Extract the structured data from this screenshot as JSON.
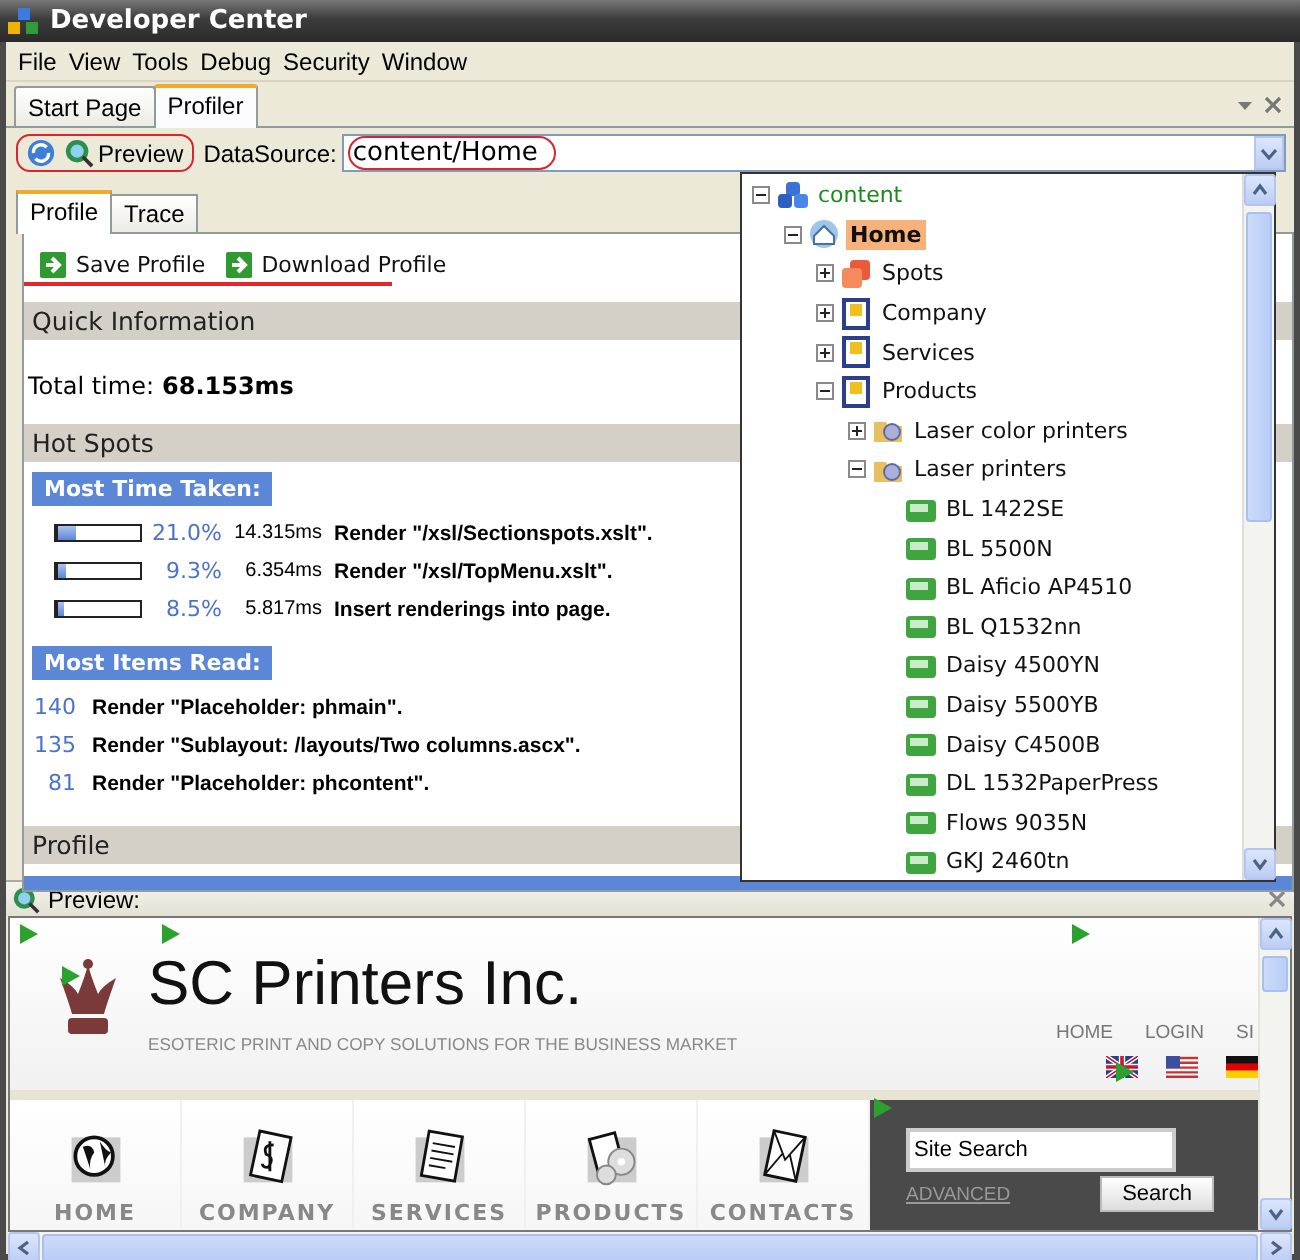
{
  "window": {
    "title": "Developer Center"
  },
  "menu": [
    "File",
    "View",
    "Tools",
    "Debug",
    "Security",
    "Window"
  ],
  "document_tabs": [
    {
      "label": "Start Page",
      "selected": false
    },
    {
      "label": "Profiler",
      "selected": true
    }
  ],
  "toolbar": {
    "preview_button": "Preview",
    "datasource_label": "DataSource:",
    "datasource_value": "content/Home"
  },
  "profiler_tabs": [
    {
      "label": "Profile",
      "selected": true
    },
    {
      "label": "Trace",
      "selected": false
    }
  ],
  "actions": [
    "Save Profile",
    "Download Profile"
  ],
  "quick_information": {
    "heading": "Quick Information",
    "total_time_label": "Total time:",
    "total_time_value": "68.153ms"
  },
  "hot_spots": {
    "heading": "Hot Spots",
    "most_time_taken": {
      "heading": "Most Time Taken:",
      "rows": [
        {
          "level": 0.21,
          "percent": "21.0%",
          "time": "14.315ms",
          "description": "Render \"/xsl/Sectionspots.xslt\"."
        },
        {
          "level": 0.093,
          "percent": "9.3%",
          "time": "6.354ms",
          "description": "Render \"/xsl/TopMenu.xslt\"."
        },
        {
          "level": 0.085,
          "percent": "8.5%",
          "time": "5.817ms",
          "description": "Insert renderings into page."
        }
      ]
    },
    "most_items_read": {
      "heading": "Most Items Read:",
      "rows": [
        {
          "count": "140",
          "description": "Render \"Placeholder: phmain\"."
        },
        {
          "count": "135",
          "description": "Render \"Sublayout: /layouts/Two columns.ascx\"."
        },
        {
          "count": "81",
          "description": "Render \"Placeholder: phcontent\"."
        }
      ]
    }
  },
  "profile": {
    "heading": "Profile"
  },
  "tree": [
    {
      "label": "content",
      "kind": "root",
      "expanded": true,
      "selected": false,
      "children": [
        {
          "label": "Home",
          "kind": "home",
          "expanded": true,
          "selected": true,
          "children": [
            {
              "label": "Spots",
              "kind": "spots",
              "expanded": false,
              "selected": false
            },
            {
              "label": "Company",
              "kind": "page",
              "expanded": false,
              "selected": false
            },
            {
              "label": "Services",
              "kind": "page",
              "expanded": false,
              "selected": false
            },
            {
              "label": "Products",
              "kind": "page",
              "expanded": true,
              "selected": false,
              "children": [
                {
                  "label": "Laser color printers",
                  "kind": "category",
                  "expanded": false,
                  "selected": false
                },
                {
                  "label": "Laser printers",
                  "kind": "category",
                  "expanded": true,
                  "selected": false,
                  "children": [
                    {
                      "label": "BL 1422SE",
                      "kind": "product",
                      "selected": false
                    },
                    {
                      "label": "BL 5500N",
                      "kind": "product",
                      "selected": false
                    },
                    {
                      "label": "BL Aficio AP4510",
                      "kind": "product",
                      "selected": false
                    },
                    {
                      "label": "BL Q1532nn",
                      "kind": "product",
                      "selected": false
                    },
                    {
                      "label": "Daisy 4500YN",
                      "kind": "product",
                      "selected": false
                    },
                    {
                      "label": "Daisy 5500YB",
                      "kind": "product",
                      "selected": false
                    },
                    {
                      "label": "Daisy C4500B",
                      "kind": "product",
                      "selected": false
                    },
                    {
                      "label": "DL 1532PaperPress",
                      "kind": "product",
                      "selected": false
                    },
                    {
                      "label": "Flows 9035N",
                      "kind": "product",
                      "selected": false
                    },
                    {
                      "label": "GKJ 2460tn",
                      "kind": "product",
                      "selected": false
                    }
                  ]
                }
              ]
            }
          ]
        }
      ]
    }
  ],
  "preview": {
    "title": "Preview:",
    "site": {
      "company_name": "SC Printers Inc.",
      "tagline": "ESOTERIC PRINT AND COPY SOLUTIONS FOR THE BUSINESS MARKET",
      "top_links": [
        "HOME",
        "LOGIN",
        "SI"
      ],
      "flags": [
        {
          "kind": "uk"
        },
        {
          "kind": "us"
        },
        {
          "kind": "de"
        }
      ],
      "nav": [
        {
          "label": "HOME",
          "kind": "globe"
        },
        {
          "label": "COMPANY",
          "kind": "dollar"
        },
        {
          "label": "SERVICES",
          "kind": "document"
        },
        {
          "label": "PRODUCTS",
          "kind": "discs"
        },
        {
          "label": "CONTACTS",
          "kind": "envelope"
        }
      ],
      "search": {
        "value": "Site Search",
        "advanced_link": "ADVANCED",
        "button": "Search"
      }
    }
  }
}
